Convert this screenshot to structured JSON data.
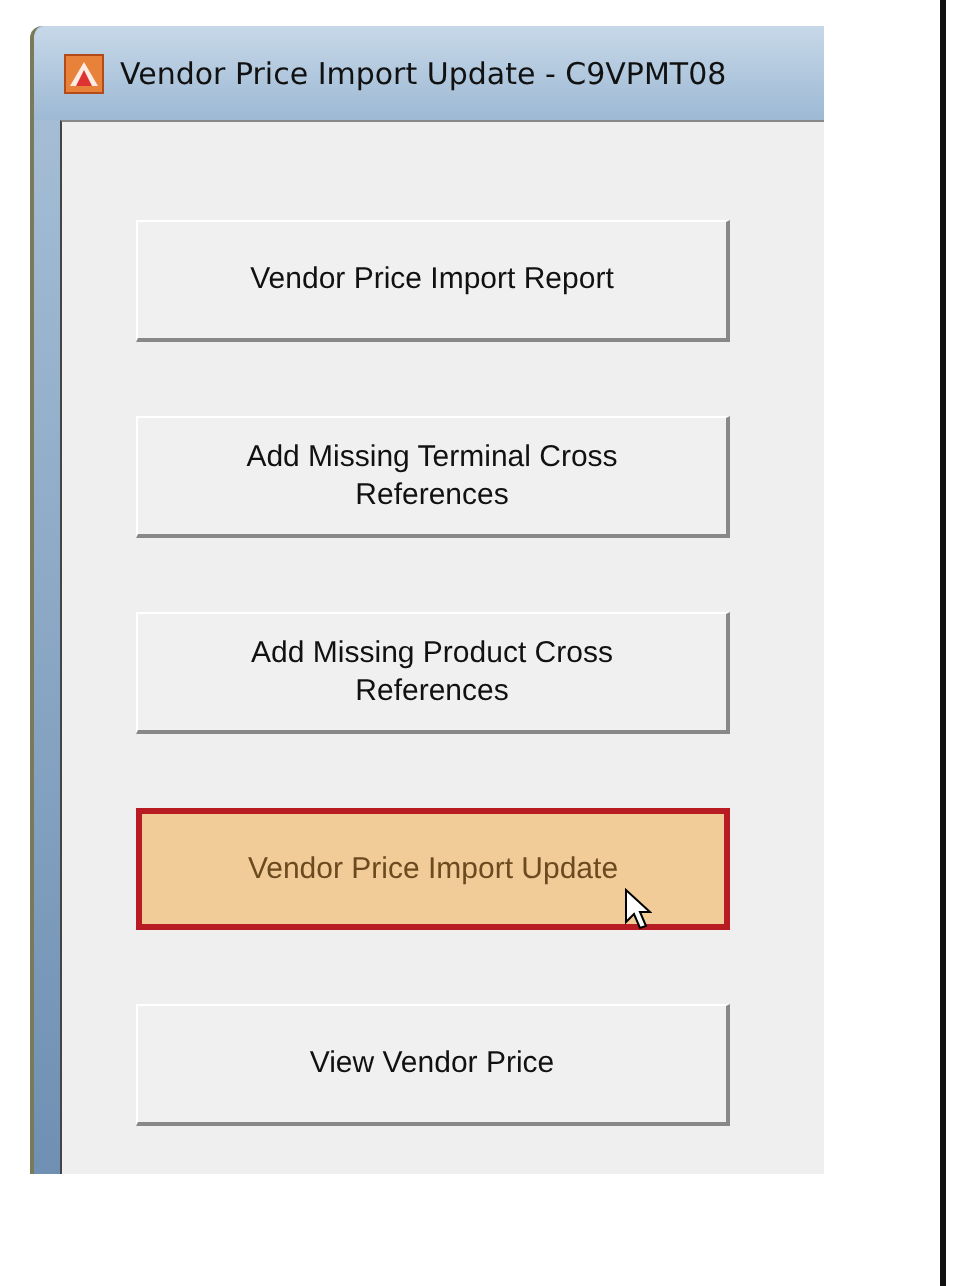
{
  "window": {
    "title": "Vendor Price Import Update - C9VPMT08"
  },
  "buttons": [
    {
      "label": "Vendor Price Import Report",
      "highlighted": false
    },
    {
      "label": "Add Missing Terminal Cross References",
      "highlighted": false
    },
    {
      "label": "Add Missing Product Cross References",
      "highlighted": false
    },
    {
      "label": "Vendor Price Import Update",
      "highlighted": true
    },
    {
      "label": "View Vendor Price",
      "highlighted": false
    }
  ]
}
